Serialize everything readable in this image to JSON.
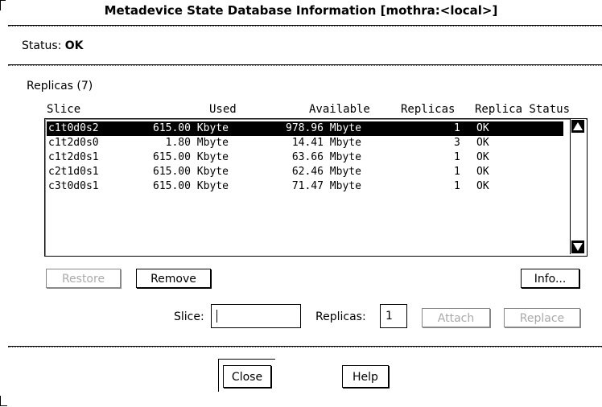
{
  "window": {
    "title": "Metadevice State Database Information [mothra:<local>]"
  },
  "status": {
    "label": "Status:",
    "value": "OK"
  },
  "replicas_group": {
    "label": "Replicas (7)",
    "columns": [
      "Slice",
      "Used",
      "Available",
      "Replicas",
      "Replica Status"
    ],
    "rows": [
      {
        "slice": "c1t0d0s2",
        "used": "615.00 Kbyte",
        "available": "978.96 Mbyte",
        "replicas": "1",
        "status": "OK",
        "selected": true
      },
      {
        "slice": "c1t2d0s0",
        "used": "  1.80 Mbyte",
        "available": " 14.41 Mbyte",
        "replicas": "3",
        "status": "OK",
        "selected": false
      },
      {
        "slice": "c1t2d0s1",
        "used": "615.00 Kbyte",
        "available": " 63.66 Mbyte",
        "replicas": "1",
        "status": "OK",
        "selected": false
      },
      {
        "slice": "c2t1d0s1",
        "used": "615.00 Kbyte",
        "available": " 62.46 Mbyte",
        "replicas": "1",
        "status": "OK",
        "selected": false
      },
      {
        "slice": "c3t0d0s1",
        "used": "615.00 Kbyte",
        "available": " 71.47 Mbyte",
        "replicas": "1",
        "status": "OK",
        "selected": false
      }
    ]
  },
  "buttons": {
    "restore": "Restore",
    "remove": "Remove",
    "info": "Info...",
    "attach": "Attach",
    "replace": "Replace",
    "close": "Close",
    "help": "Help"
  },
  "fields": {
    "slice_label": "Slice:",
    "slice_value": "",
    "replicas_label": "Replicas:",
    "replicas_value": "1"
  }
}
